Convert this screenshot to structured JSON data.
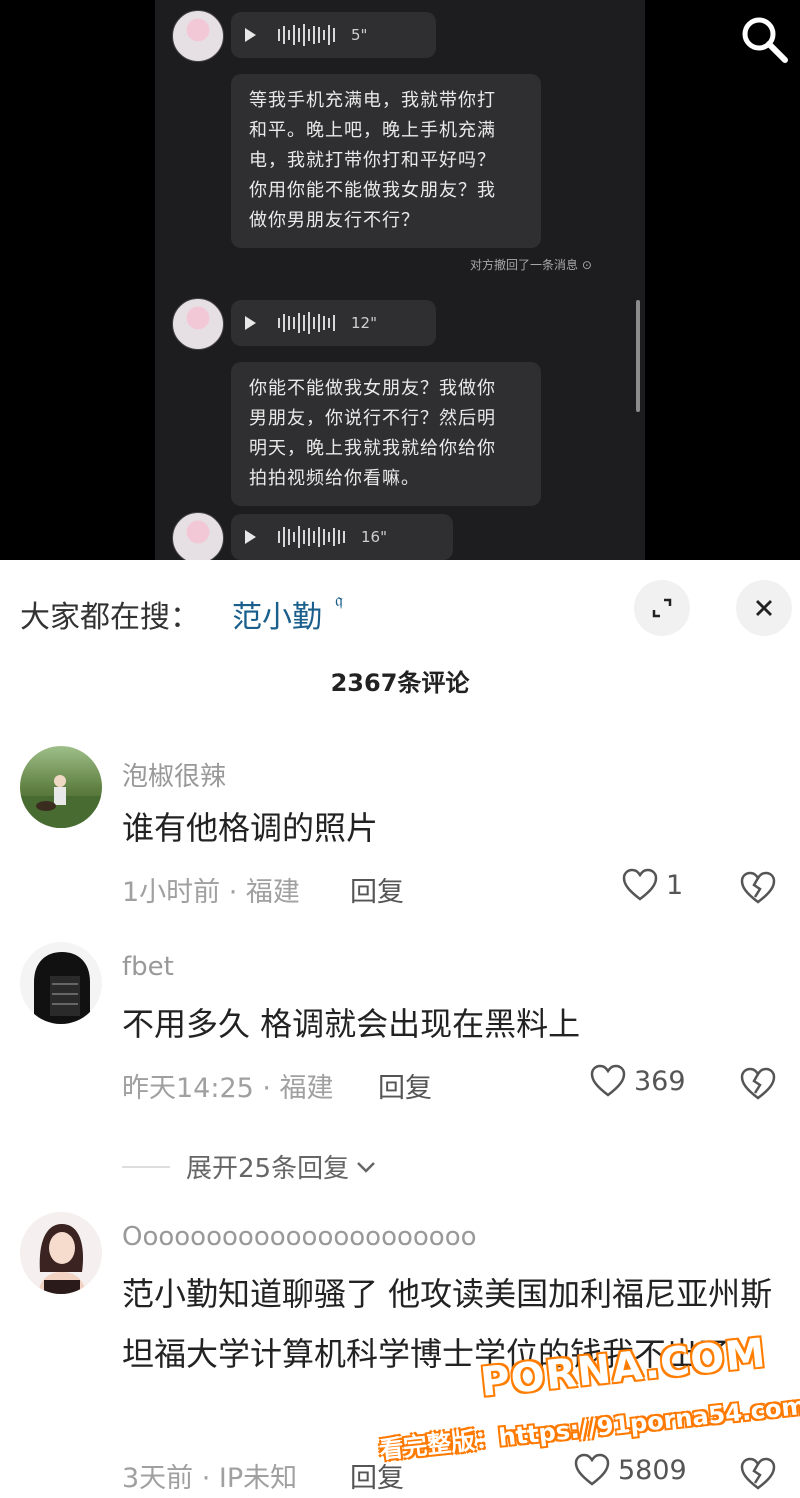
{
  "video": {
    "messages": [
      {
        "duration": "5\"",
        "text": "等我手机充满电，我就带你打\n和平。晚上吧，晚上手机充满\n电，我就打带你打和平好吗？\n你用你能不能做我女朋友？我\n做你男朋友行不行？"
      },
      {
        "duration": "12\"",
        "text": "你能不能做我女朋友？我做你\n男朋友，你说行不行？然后明\n明天，晚上我就我就给你给你\n拍拍视频给你看嘛。"
      },
      {
        "duration": "16\""
      }
    ],
    "recall_notice": "对方撤回了一条消息"
  },
  "panel": {
    "hot_label": "大家都在搜：",
    "hot_term": "范小勤",
    "comment_count": "2367条评论",
    "comments": [
      {
        "name": "泡椒很辣",
        "text": "谁有他格调的照片",
        "meta": "1小时前 · 福建",
        "reply": "回复",
        "likes": "1"
      },
      {
        "name": "fbet",
        "text": "不用多久 格调就会出现在黑料上",
        "meta": "昨天14:25 · 福建",
        "reply": "回复",
        "likes": "369",
        "expand": "展开25条回复"
      },
      {
        "name": "Oooooooooooooooooooooo",
        "text": "范小勤知道聊骚了 他攻读美国加利福尼亚州斯坦福大学计算机科学博士学位的钱我不出了",
        "meta": "3天前 · IP未知",
        "reply": "回复",
        "likes": "5809"
      }
    ]
  },
  "watermark": {
    "brand": "PORNA.COM",
    "line": "看完整版：https://91porna54.com"
  }
}
